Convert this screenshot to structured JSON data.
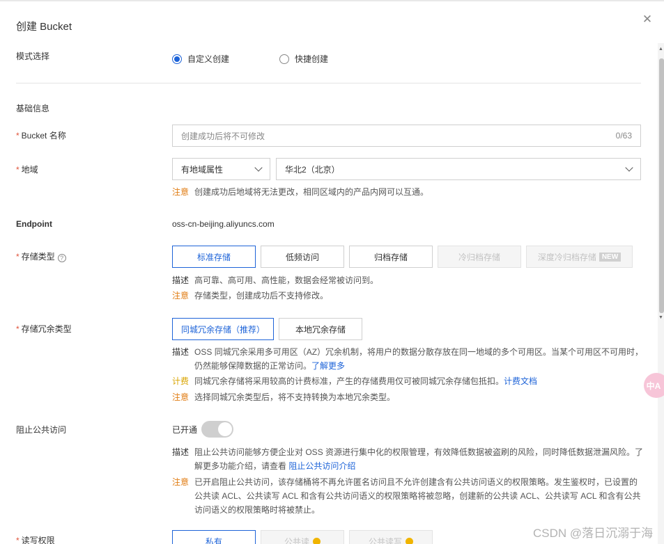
{
  "header": {
    "title": "创建 Bucket"
  },
  "mode": {
    "label": "模式选择",
    "options": [
      {
        "label": "自定义创建",
        "selected": true
      },
      {
        "label": "快捷创建",
        "selected": false
      }
    ]
  },
  "basic": {
    "section_title": "基础信息"
  },
  "bucket_name": {
    "required": "*",
    "label": "Bucket 名称",
    "placeholder": "创建成功后将不可修改",
    "counter": "0/63"
  },
  "region": {
    "required": "*",
    "label": "地域",
    "attr_select": "有地域属性",
    "region_select": "华北2（北京）",
    "note_tag": "注意",
    "note_text": "创建成功后地域将无法更改，相同区域内的产品内网可以互通。"
  },
  "endpoint": {
    "label": "Endpoint",
    "value": "oss-cn-beijing.aliyuncs.com"
  },
  "storage_type": {
    "required": "*",
    "label": "存储类型",
    "help": "?",
    "options": [
      {
        "label": "标准存储",
        "state": "selected"
      },
      {
        "label": "低频访问",
        "state": "normal"
      },
      {
        "label": "归档存储",
        "state": "normal"
      },
      {
        "label": "冷归档存储",
        "state": "disabled"
      },
      {
        "label": "深度冷归档存储",
        "state": "disabled"
      }
    ],
    "new_badge": "NEW",
    "desc_tag": "描述",
    "desc_text": "高可靠、高可用、高性能，数据会经常被访问到。",
    "note_tag": "注意",
    "note_text": "存储类型，创建成功后不支持修改。"
  },
  "redundancy": {
    "required": "*",
    "label": "存储冗余类型",
    "options": [
      {
        "label": "同城冗余存储（推荐）",
        "state": "selected"
      },
      {
        "label": "本地冗余存储",
        "state": "normal"
      }
    ],
    "desc_tag": "描述",
    "desc_text_1": "OSS 同城冗余采用多可用区（AZ）冗余机制，将用户的数据分散存放在同一地域的多个可用区。当某个可用区不可用时，",
    "desc_text_2": "仍然能够保障数据的正常访问。",
    "desc_link": "了解更多",
    "fee_tag": "计费",
    "fee_text": "同城冗余存储将采用较高的计费标准，产生的存储费用仅可被同城冗余存储包抵扣。",
    "fee_link": "计费文档",
    "note_tag": "注意",
    "note_text": "选择同城冗余类型后，将不支持转换为本地冗余类型。"
  },
  "public_access": {
    "label": "阻止公共访问",
    "status": "已开通",
    "desc_tag": "描述",
    "desc_text_1": "阻止公共访问能够方便企业对 OSS 资源进行集中化的权限管理，有效降低数据被盗刷的风险，同时降低数据泄漏风险。了",
    "desc_text_2": "解更多功能介绍，请查看",
    "desc_link": "阻止公共访问介绍",
    "note_tag": "注意",
    "note_text_1": "已开启阻止公共访问，该存储桶将不再允许匿名访问且不允许创建含有公共访问语义的权限策略。发生鉴权时，已设置的",
    "note_text_2": "公共读 ACL、公共读写 ACL 和含有公共访问语义的权限策略将被忽略，创建新的公共读 ACL、公共读写 ACL 和含有公共",
    "note_text_3": "访问语义的权限策略时将被禁止。"
  },
  "acl": {
    "required": "*",
    "label": "读写权限",
    "options": [
      {
        "label": "私有",
        "state": "selected"
      },
      {
        "label": "公共读",
        "state": "disabled"
      },
      {
        "label": "公共读写",
        "state": "disabled"
      }
    ]
  },
  "floating": {
    "label": "中A"
  },
  "watermark": {
    "text": "CSDN @落日沉溺于海"
  }
}
